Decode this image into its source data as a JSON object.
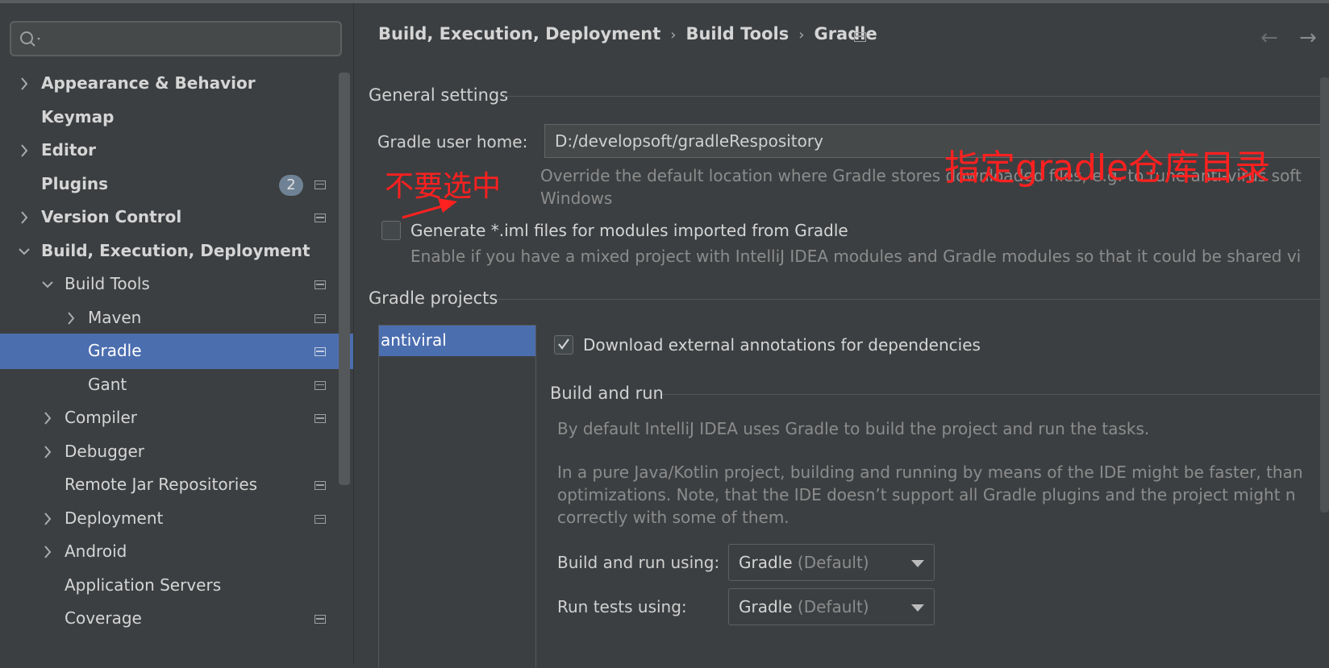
{
  "search": {
    "placeholder": "",
    "value": ""
  },
  "sidebar": {
    "items": [
      {
        "label": "Appearance & Behavior",
        "expandable": true,
        "expanded": false,
        "bold": true,
        "indent": 0
      },
      {
        "label": "Keymap",
        "expandable": false,
        "bold": true,
        "indent": 0
      },
      {
        "label": "Editor",
        "expandable": true,
        "expanded": false,
        "bold": true,
        "indent": 0
      },
      {
        "label": "Plugins",
        "expandable": false,
        "bold": true,
        "indent": 0,
        "badge": "2",
        "project_icon": true
      },
      {
        "label": "Version Control",
        "expandable": true,
        "expanded": false,
        "bold": true,
        "indent": 0,
        "project_icon": true
      },
      {
        "label": "Build, Execution, Deployment",
        "expandable": true,
        "expanded": true,
        "bold": true,
        "indent": 0
      },
      {
        "label": "Build Tools",
        "expandable": true,
        "expanded": true,
        "bold": false,
        "indent": 1,
        "project_icon": true
      },
      {
        "label": "Maven",
        "expandable": true,
        "expanded": false,
        "bold": false,
        "indent": 2,
        "project_icon": true
      },
      {
        "label": "Gradle",
        "expandable": false,
        "bold": false,
        "indent": 2,
        "project_icon": true,
        "selected": true
      },
      {
        "label": "Gant",
        "expandable": false,
        "bold": false,
        "indent": 2,
        "project_icon": true
      },
      {
        "label": "Compiler",
        "expandable": true,
        "expanded": false,
        "bold": false,
        "indent": 1,
        "project_icon": true
      },
      {
        "label": "Debugger",
        "expandable": true,
        "expanded": false,
        "bold": false,
        "indent": 1
      },
      {
        "label": "Remote Jar Repositories",
        "expandable": false,
        "bold": false,
        "indent": 1,
        "project_icon": true
      },
      {
        "label": "Deployment",
        "expandable": true,
        "expanded": false,
        "bold": false,
        "indent": 1,
        "project_icon": true
      },
      {
        "label": "Android",
        "expandable": true,
        "expanded": false,
        "bold": false,
        "indent": 1
      },
      {
        "label": "Application Servers",
        "expandable": false,
        "bold": false,
        "indent": 1
      },
      {
        "label": "Coverage",
        "expandable": false,
        "bold": false,
        "indent": 1,
        "project_icon": true
      }
    ]
  },
  "breadcrumb": {
    "parts": [
      "Build, Execution, Deployment",
      "Build Tools",
      "Gradle"
    ],
    "separator": "›",
    "back_icon": "arrow-left-icon",
    "forward_icon": "arrow-right-icon"
  },
  "general": {
    "title": "General settings",
    "user_home_label": "Gradle user home:",
    "user_home_value": "D:/developsoft/gradleRespository",
    "user_home_hint_1": "Override the default location where Gradle stores downloaded files, e.g. to tune anti-virus soft",
    "user_home_hint_2": "Windows",
    "iml_label": "Generate *.iml files for modules imported from Gradle",
    "iml_checked": false,
    "iml_hint": "Enable if you have a mixed project with IntelliJ IDEA modules and Gradle modules so that it could be shared vi"
  },
  "projects": {
    "title": "Gradle projects",
    "list": [
      "antiviral"
    ],
    "download_annotations_label": "Download external annotations for dependencies",
    "download_annotations_checked": true
  },
  "build_run": {
    "title": "Build and run",
    "para1": "By default IntelliJ IDEA uses Gradle to build the project and run the tasks.",
    "para2_line1": "In a pure Java/Kotlin project, building and running by means of the IDE might be faster, than",
    "para2_line2": "optimizations. Note, that the IDE doesn’t support all Gradle plugins and the project might n",
    "para2_line3": "correctly with some of them.",
    "build_using_label": "Build and run using:",
    "build_using_value": "Gradle",
    "build_using_suffix": "(Default)",
    "tests_using_label": "Run tests using:",
    "tests_using_value": "Gradle",
    "tests_using_suffix": "(Default)"
  },
  "annotations": {
    "note_top": "指定gradle仓库目录",
    "note_checkbox": "不要选中",
    "color": "#ff2020"
  },
  "colors": {
    "background": "#3c3f41",
    "selection": "#4b6eaf",
    "text": "#bbbbbb"
  }
}
